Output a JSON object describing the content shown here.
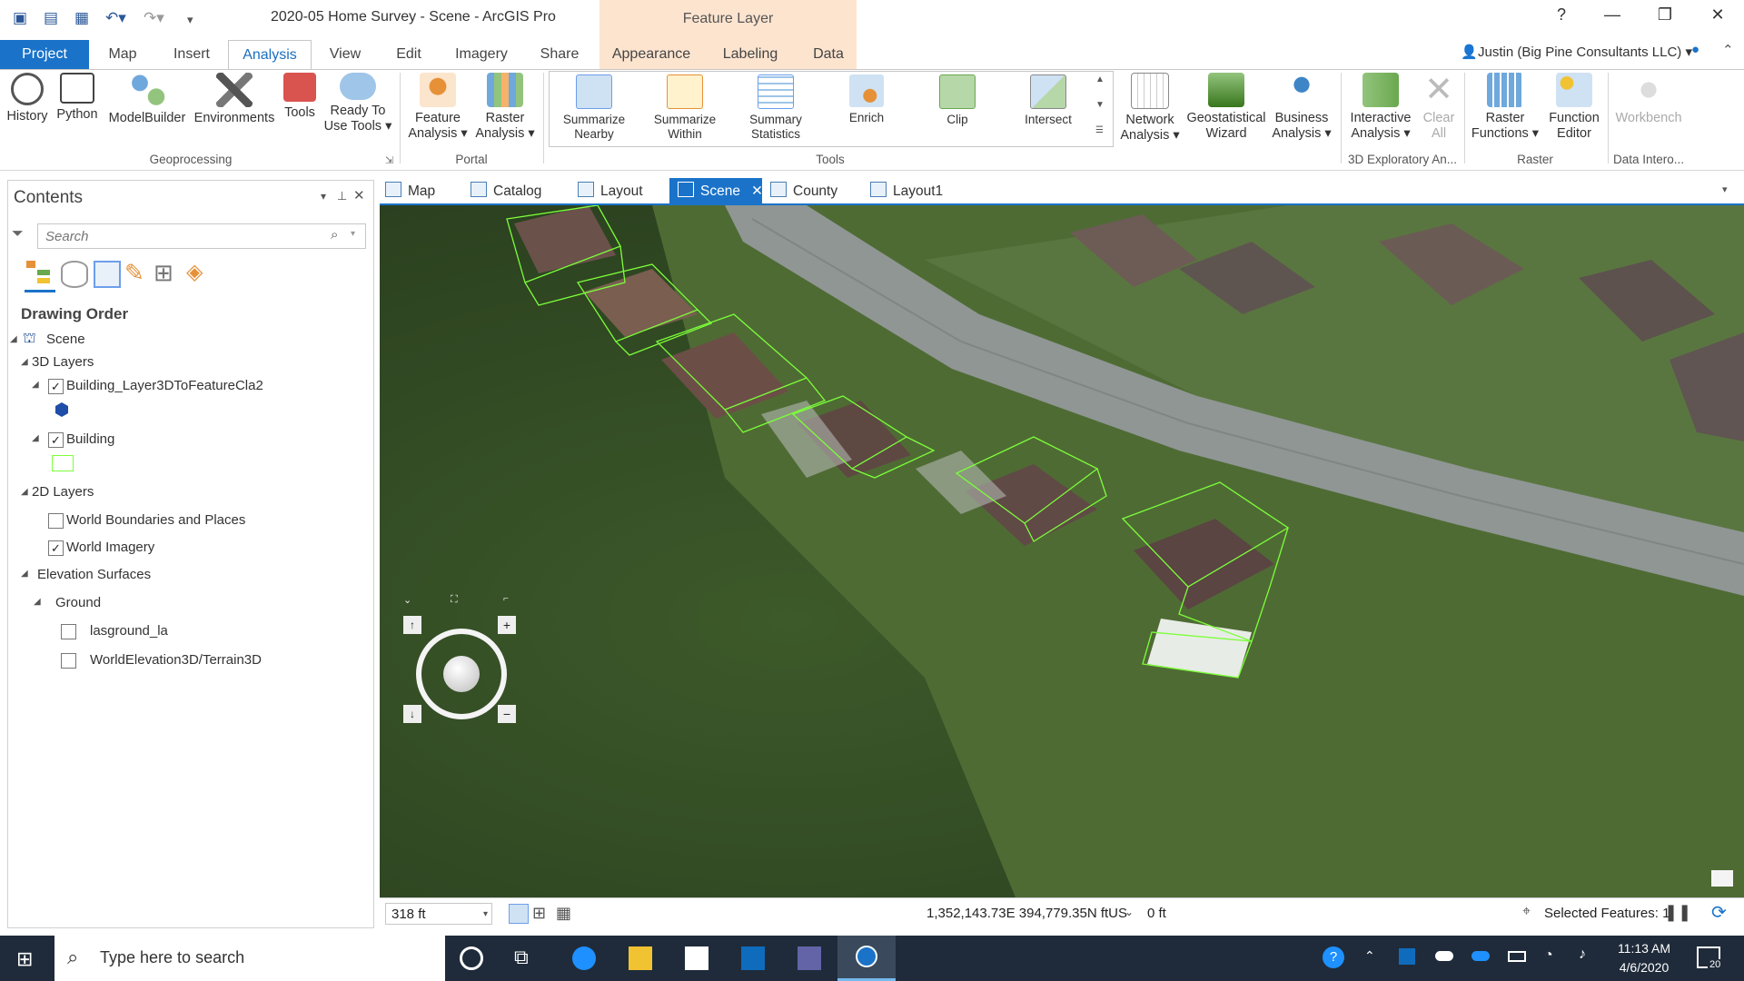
{
  "app": {
    "title": "2020-05 Home Survey - Scene - ArcGIS Pro",
    "context_tab": "Feature Layer",
    "help": "?",
    "user": "Justin (Big Pine Consultants LLC) ▾"
  },
  "ribbon_tabs": [
    "Project",
    "Map",
    "Insert",
    "Analysis",
    "View",
    "Edit",
    "Imagery",
    "Share",
    "Appearance",
    "Labeling",
    "Data"
  ],
  "ribbon": {
    "geoprocessing": {
      "label": "Geoprocessing",
      "buttons": [
        "History",
        "Python",
        "ModelBuilder",
        "Environments",
        "Tools",
        "Ready To",
        "Use Tools ▾"
      ]
    },
    "portal": {
      "label": "Portal",
      "buttons": [
        "Feature",
        "Analysis ▾",
        "Raster",
        "Analysis ▾"
      ]
    },
    "tools": {
      "label": "Tools",
      "buttons": [
        {
          "l1": "Summarize",
          "l2": "Nearby"
        },
        {
          "l1": "Summarize",
          "l2": "Within"
        },
        {
          "l1": "Summary",
          "l2": "Statistics"
        },
        {
          "l1": "Enrich",
          "l2": ""
        },
        {
          "l1": "Clip",
          "l2": ""
        },
        {
          "l1": "Intersect",
          "l2": ""
        }
      ]
    },
    "workflows": [
      {
        "l1": "Network",
        "l2": "Analysis ▾"
      },
      {
        "l1": "Geostatistical",
        "l2": "Wizard"
      },
      {
        "l1": "Business",
        "l2": "Analysis ▾"
      }
    ],
    "exploratory": {
      "label": "3D Exploratory An...",
      "b1": {
        "l1": "Interactive",
        "l2": "Analysis ▾"
      },
      "b2": {
        "l1": "Clear",
        "l2": "All"
      }
    },
    "raster": {
      "label": "Raster",
      "b1": {
        "l1": "Raster",
        "l2": "Functions ▾"
      },
      "b2": {
        "l1": "Function",
        "l2": "Editor"
      }
    },
    "data_interop": {
      "label": "Data Intero...",
      "b1": "Workbench"
    }
  },
  "contents": {
    "title": "Contents",
    "search_placeholder": "Search",
    "drawing_order": "Drawing Order",
    "scene": "Scene",
    "layers_3d": "3D Layers",
    "layer_a": "Building_Layer3DToFeatureCla2",
    "layer_b": "Building",
    "layers_2d": "2D Layers",
    "world_boundaries": "World Boundaries and Places",
    "world_imagery": "World Imagery",
    "elevation": "Elevation Surfaces",
    "ground": "Ground",
    "lasground": "lasground_la",
    "terrain": "WorldElevation3D/Terrain3D"
  },
  "view_tabs": [
    "Map",
    "Catalog",
    "Layout",
    "Scene",
    "County",
    "Layout1"
  ],
  "status": {
    "scale": "318 ft",
    "coords": "1,352,143.73E 394,779.35N ftUS",
    "elevation": "0 ft",
    "selected": "Selected Features: 1"
  },
  "taskbar": {
    "search_text": "Type here to search",
    "time": "11:13 AM",
    "date": "4/6/2020",
    "notifications": "20"
  },
  "colors": {
    "accent": "#1a73c9",
    "context_tab": "#fde4cf",
    "selection": "#cce4f7",
    "taskbar": "#1f2b3a",
    "footprint": "#7cff3a"
  }
}
